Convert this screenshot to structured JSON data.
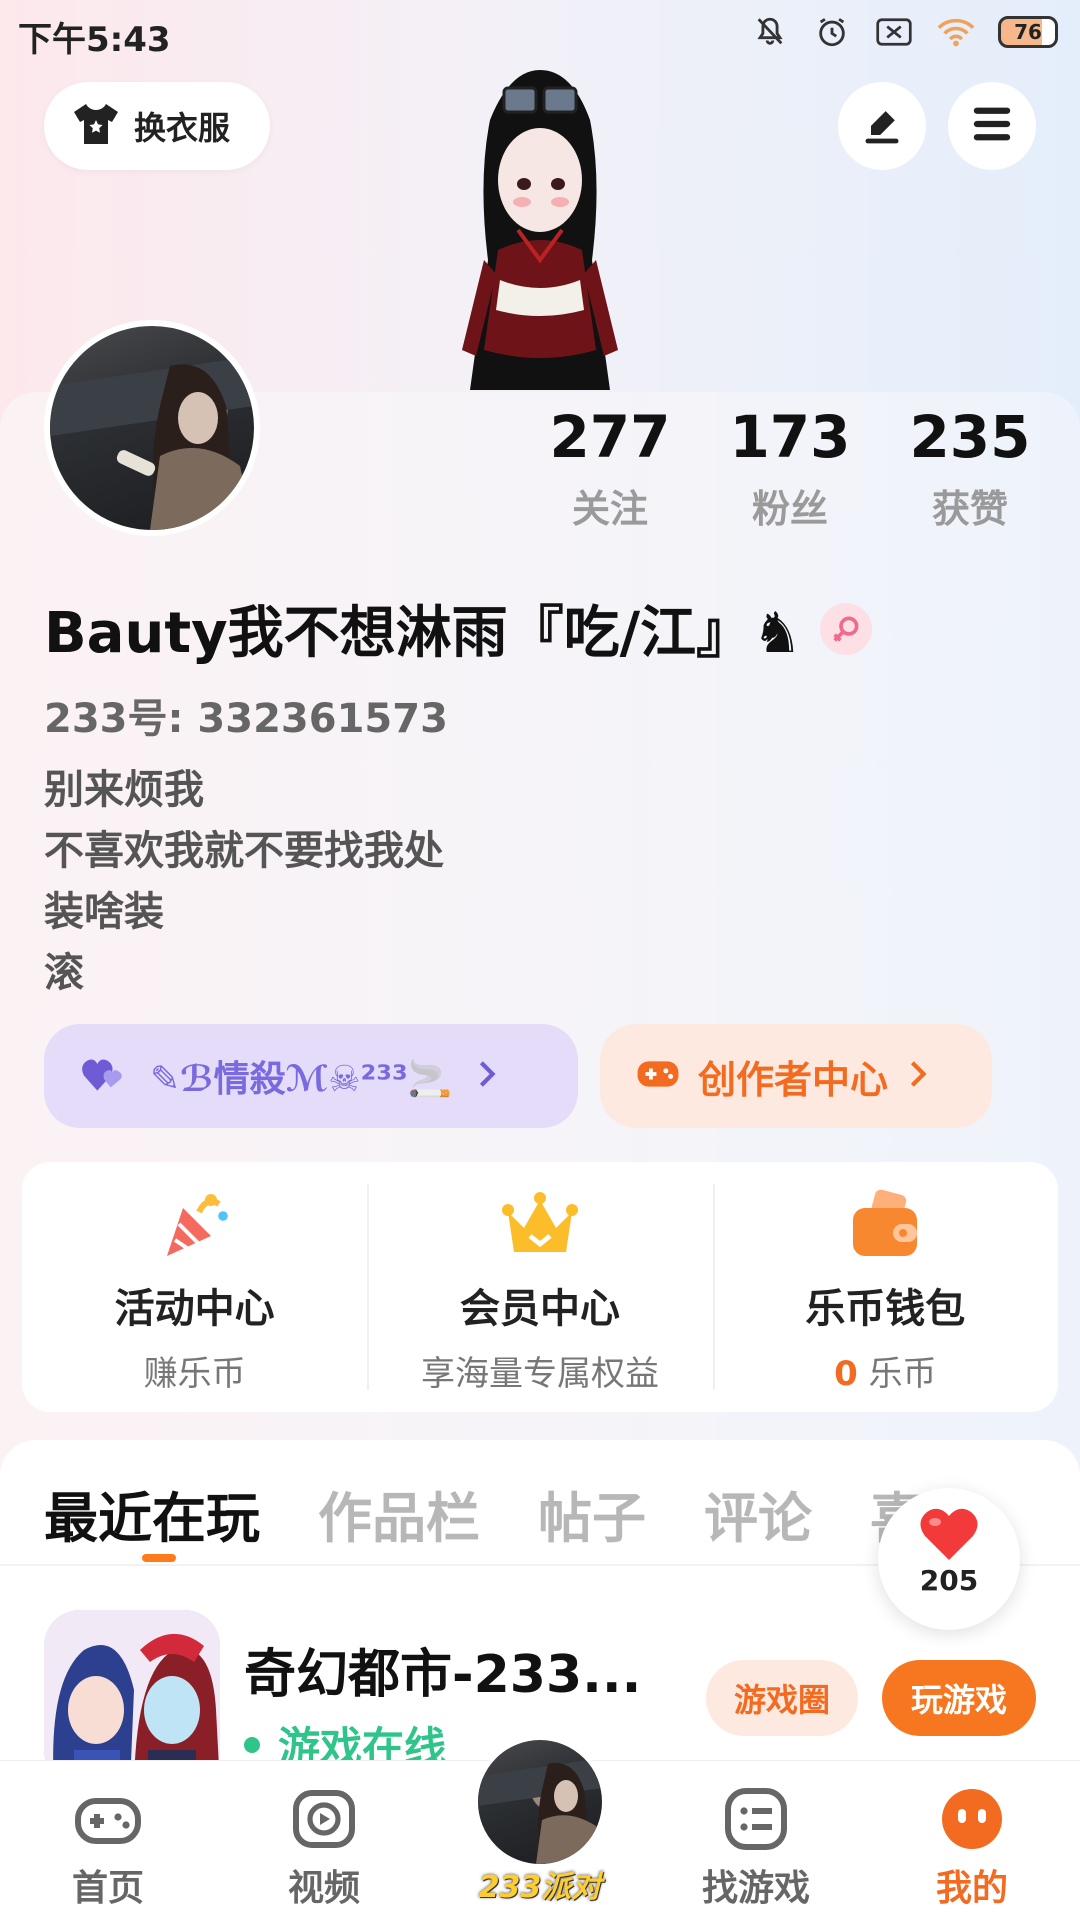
{
  "status_bar": {
    "time": "下午5:43",
    "battery": "76"
  },
  "header": {
    "outfit_label": "换衣服"
  },
  "profile": {
    "stats": [
      {
        "value": "277",
        "label": "关注"
      },
      {
        "value": "173",
        "label": "粉丝"
      },
      {
        "value": "235",
        "label": "获赞"
      }
    ],
    "username": "Bauty我不想淋雨『吃/江』♞",
    "account_id": "233号: 332361573",
    "bio_lines": [
      "别来烦我",
      "不喜欢我就不要找我处",
      "装啥装",
      "滚"
    ]
  },
  "group_pill": {
    "name": "✎ℬ情殺ℳ☠²³³🚬"
  },
  "creator_pill": {
    "label": "创作者中心"
  },
  "services": [
    {
      "title": "活动中心",
      "subtitle": "赚乐币"
    },
    {
      "title": "会员中心",
      "subtitle": "享海量专属权益"
    },
    {
      "title": "乐币钱包",
      "coin": "0",
      "subtitle": "乐币"
    }
  ],
  "tabs": [
    "最近在玩",
    "作品栏",
    "帖子",
    "评论",
    "喜欢"
  ],
  "like_bubble": {
    "count": "205"
  },
  "recent_game": {
    "title": "奇幻都市-233...",
    "status": "游戏在线",
    "circle_button": "游戏圈",
    "play_button": "玩游戏"
  },
  "bottom_nav": {
    "items": [
      "首页",
      "视频",
      "找游戏",
      "我的"
    ],
    "center_label": "233派对"
  },
  "colors": {
    "accent": "#f36b21",
    "online": "#2fc48a",
    "group_pill_text": "#7a6ae0"
  }
}
